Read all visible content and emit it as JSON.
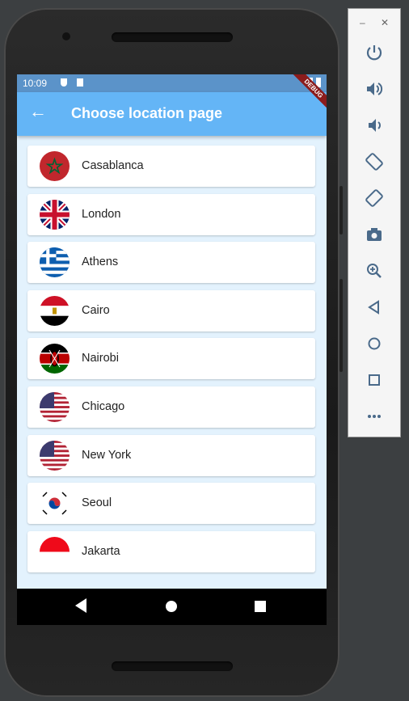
{
  "status_bar": {
    "time": "10:09",
    "debug_banner": "DEBUG"
  },
  "app_bar": {
    "title": "Choose location page",
    "back_icon": "arrow-back-icon"
  },
  "locations": [
    {
      "city": "Casablanca",
      "flag": "morocco-flag-icon"
    },
    {
      "city": "London",
      "flag": "uk-flag-icon"
    },
    {
      "city": "Athens",
      "flag": "greece-flag-icon"
    },
    {
      "city": "Cairo",
      "flag": "egypt-flag-icon"
    },
    {
      "city": "Nairobi",
      "flag": "kenya-flag-icon"
    },
    {
      "city": "Chicago",
      "flag": "usa-flag-icon"
    },
    {
      "city": "New York",
      "flag": "usa-flag-icon"
    },
    {
      "city": "Seoul",
      "flag": "south-korea-flag-icon"
    },
    {
      "city": "Jakarta",
      "flag": "indonesia-flag-icon"
    }
  ],
  "colors": {
    "app_bar": "#64b5f6",
    "status_bar": "#5b93c9",
    "background": "#e3f2fd"
  },
  "emulator_panel": [
    "power-icon",
    "volume-up-icon",
    "volume-down-icon",
    "rotate-left-icon",
    "rotate-right-icon",
    "camera-icon",
    "zoom-icon",
    "back-icon",
    "home-icon",
    "overview-icon",
    "more-icon"
  ]
}
